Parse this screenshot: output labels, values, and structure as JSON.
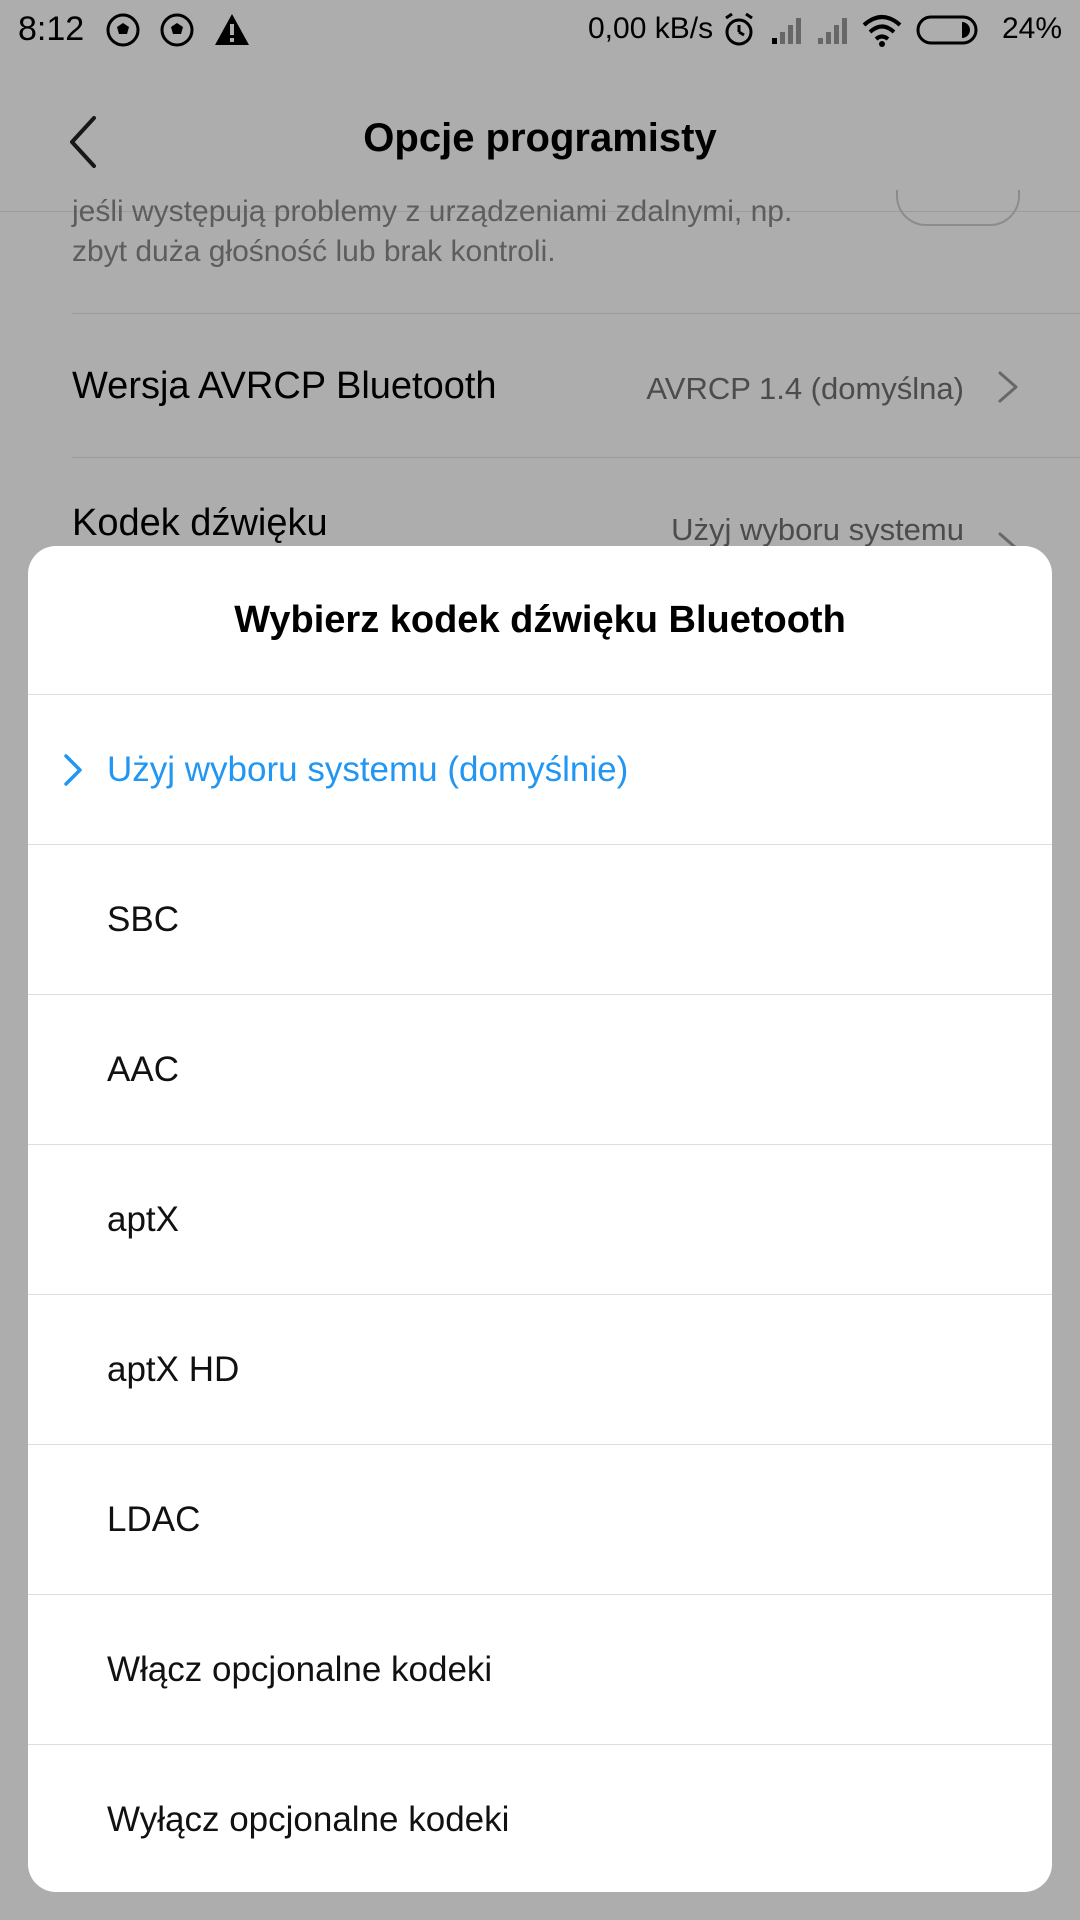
{
  "status_bar": {
    "time": "8:12",
    "network_speed": "0,00 kB/s",
    "battery_percent": "24%",
    "icons": [
      "soccer-ball-icon",
      "soccer-ball-icon",
      "warning-icon",
      "alarm-icon",
      "signal-icon",
      "signal-icon",
      "wifi-icon",
      "battery-icon"
    ]
  },
  "header": {
    "title": "Opcje programisty",
    "back_icon": "chevron-left-icon"
  },
  "background": {
    "description": "jeśli występują problemy z urządzeniami zdalnymi, np.\nzbyt duża głośność lub brak kontroli.",
    "rows": [
      {
        "label": "Wersja AVRCP Bluetooth",
        "value": "AVRCP 1.4 (domyślna)"
      },
      {
        "label": "Kodek dźwięku",
        "value": "Użyj wyboru systemu"
      }
    ]
  },
  "dialog": {
    "title": "Wybierz kodek dźwięku Bluetooth",
    "options": [
      {
        "label": "Użyj wyboru systemu (domyślnie)",
        "selected": true
      },
      {
        "label": "SBC",
        "selected": false
      },
      {
        "label": "AAC",
        "selected": false
      },
      {
        "label": "aptX",
        "selected": false
      },
      {
        "label": "aptX HD",
        "selected": false
      },
      {
        "label": "LDAC",
        "selected": false
      },
      {
        "label": "Włącz opcjonalne kodeki",
        "selected": false
      },
      {
        "label": "Wyłącz opcjonalne kodeki",
        "selected": false
      }
    ]
  },
  "colors": {
    "accent": "#2196f3",
    "scrim": "rgba(0,0,0,0.32)",
    "dialog_background": "#ffffff"
  }
}
